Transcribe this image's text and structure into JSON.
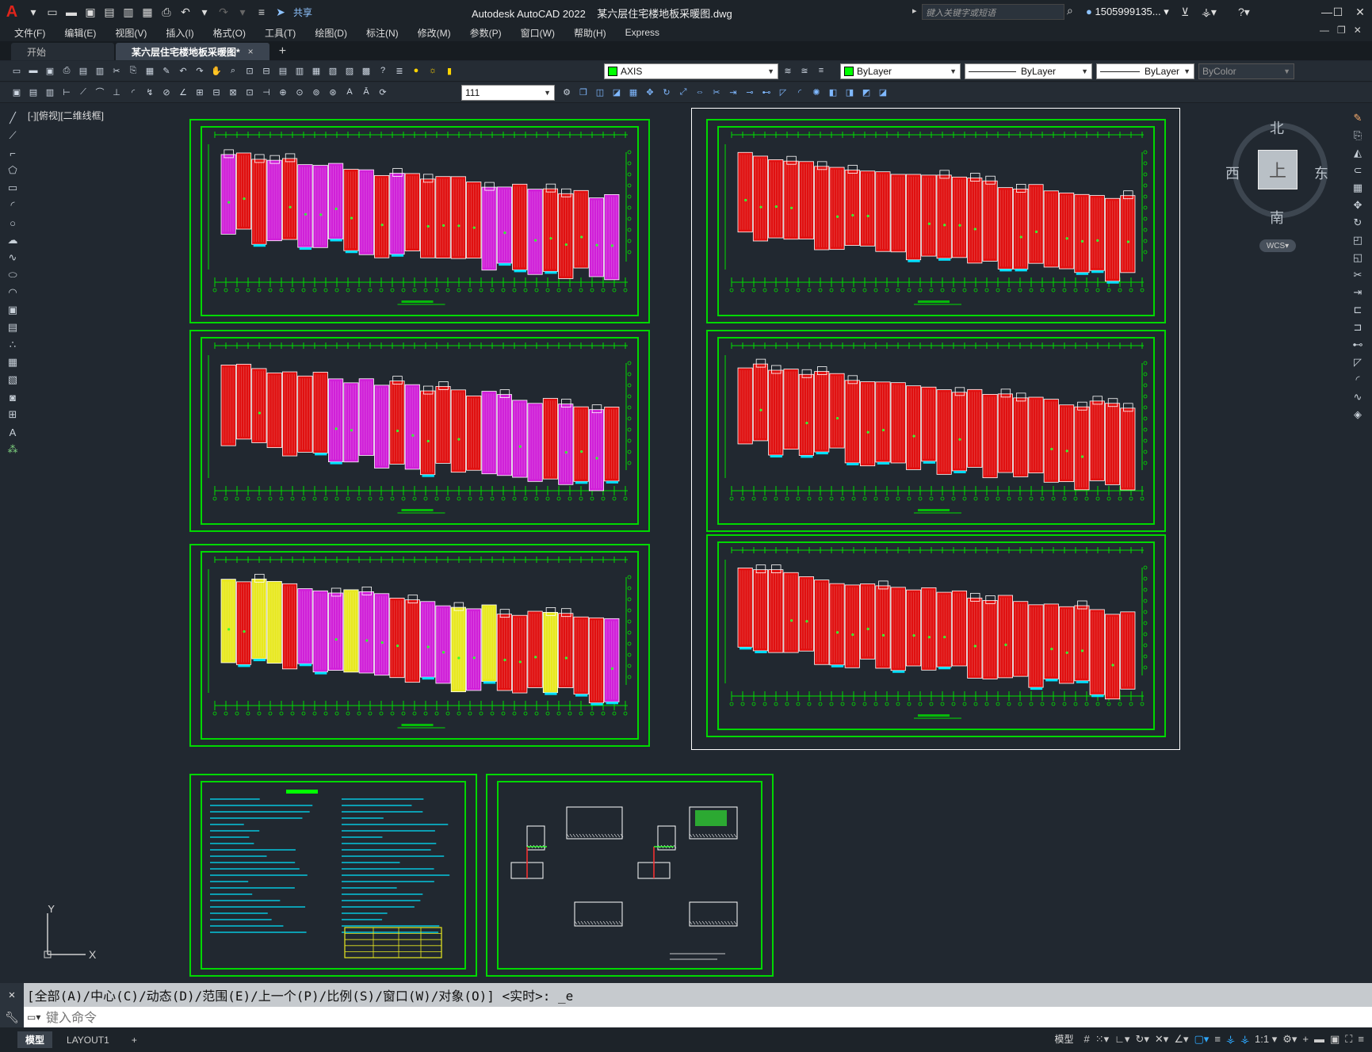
{
  "titlebar": {
    "logo": "A",
    "share_label": "共享",
    "app_title": "Autodesk AutoCAD 2022",
    "file_name": "某六层住宅楼地板采暖图.dwg",
    "search_placeholder": "键入关键字或短语",
    "user": "1505999135...",
    "help": "?"
  },
  "menu": {
    "items": [
      "文件(F)",
      "编辑(E)",
      "视图(V)",
      "插入(I)",
      "格式(O)",
      "工具(T)",
      "绘图(D)",
      "标注(N)",
      "修改(M)",
      "参数(P)",
      "窗口(W)",
      "帮助(H)",
      "Express"
    ]
  },
  "tabs": {
    "start": "开始",
    "active": "某六层住宅楼地板采暖图*",
    "close": "×",
    "add": "+"
  },
  "toolbar": {
    "layer": "AXIS",
    "color": "ByLayer",
    "linetype": "ByLayer",
    "lineweight": "ByLayer",
    "plotstyle": "ByColor",
    "dimstyle": "111"
  },
  "viewport": {
    "label": "[-][俯视][二维线框]",
    "compass": {
      "n": "北",
      "s": "南",
      "w": "西",
      "e": "东",
      "face": "上",
      "wcs": "WCS"
    },
    "ucs": {
      "x": "X",
      "y": "Y"
    }
  },
  "command": {
    "history": "[全部(A)/中心(C)/动态(D)/范围(E)/上一个(P)/比例(S)/窗口(W)/对象(O)] <实时>: _e",
    "placeholder": "键入命令"
  },
  "statusbar": {
    "tabs": [
      "模型",
      "LAYOUT1"
    ],
    "add": "+",
    "model": "模型",
    "scale": "1:1"
  },
  "colors": {
    "background": "#212830",
    "frame": "#00d800",
    "floor_red": "#e01010",
    "floor_magenta": "#d020d8",
    "floor_yellow": "#e8e820"
  }
}
